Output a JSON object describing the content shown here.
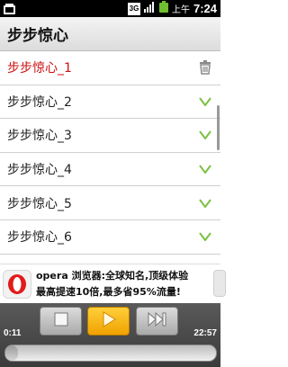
{
  "status_bar": {
    "network_label": "3G",
    "ampm": "上午",
    "time": "7:24"
  },
  "header": {
    "title": "步步惊心"
  },
  "playlist": {
    "items": [
      {
        "label": "步步惊心_1",
        "icon": "trash-icon",
        "active": true
      },
      {
        "label": "步步惊心_2",
        "icon": "chevron-down-icon"
      },
      {
        "label": "步步惊心_3",
        "icon": "chevron-down-icon"
      },
      {
        "label": "步步惊心_4",
        "icon": "chevron-down-icon"
      },
      {
        "label": "步步惊心_5",
        "icon": "chevron-down-icon"
      },
      {
        "label": "步步惊心_6",
        "icon": "chevron-down-icon"
      }
    ]
  },
  "ad": {
    "line1": "opera 浏览器:全球知名,顶级体验",
    "line2": "最高提速10倍,最多省95%流量!"
  },
  "player": {
    "current_time": "0:11",
    "total_time": "22:57",
    "progress": 0.008,
    "controls": [
      "stop-icon",
      "play-icon",
      "next-icon"
    ]
  },
  "colors": {
    "active_item": "#cc1111",
    "chevron": "#7bc142",
    "play_button": "#f0a200"
  }
}
